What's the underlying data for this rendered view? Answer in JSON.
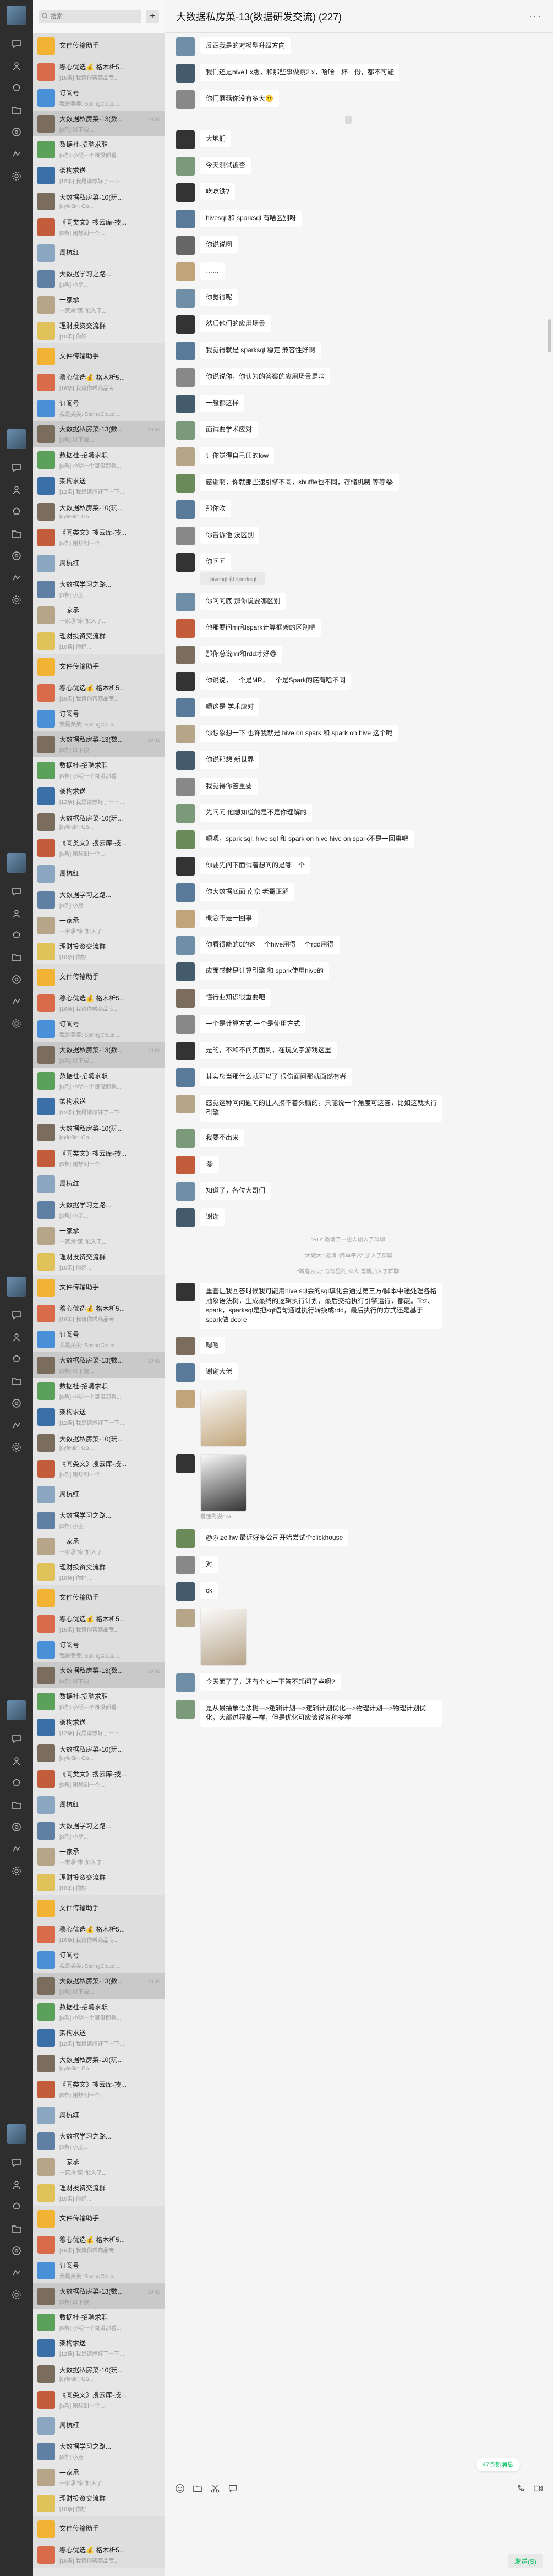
{
  "search": {
    "placeholder": "搜索"
  },
  "conversation": {
    "title": "大数据私房菜-13(数据研发交流) (227)",
    "more_icon": "more-dots-icon",
    "new_messages_tip": "47条新消息",
    "send_label": "发送(S)"
  },
  "chat_list": [
    {
      "name": "文件传输助手",
      "time": "",
      "preview": "",
      "color": "#f2b233",
      "pinned": true
    },
    {
      "name": "穆心优选💰 格木析5...",
      "time": "",
      "preview": "[16条] 我请你帮商品专...",
      "color": "#d96b4b",
      "badge": "",
      "pinned": true
    },
    {
      "name": "订阅号",
      "time": "",
      "preview": "我是美美: SpringCloud...",
      "color": "#4a90d9",
      "pinned": true
    },
    {
      "name": "大数据私房菜-13(数...",
      "time": "19:41",
      "preview": "[3条] 以下被...",
      "color": "#7a6d5e",
      "active": true
    },
    {
      "name": "数据社-招聘求职",
      "time": "",
      "preview": "[6条] 小明一个哥没都看...",
      "color": "#5ba05b",
      "badge": ""
    },
    {
      "name": "架构求送",
      "time": "",
      "preview": "[12条] 我是请想好了一下...",
      "color": "#3a6fa8",
      "badge": ""
    },
    {
      "name": "大数据私房菜-10(玩...",
      "time": "",
      "preview": "[cyfe6in: Go...",
      "color": "#7a6d5e",
      "badge": ""
    },
    {
      "name": "《同类文》搜云库-技...",
      "time": "",
      "preview": "[5条] 刚想到一个...",
      "color": "#c25c3a",
      "badge": ""
    },
    {
      "name": "周杭红",
      "time": "",
      "preview": "",
      "color": "#8aa6c1"
    },
    {
      "name": "大数据学习之路...",
      "time": "",
      "preview": "[3条] 小朋...",
      "color": "#5f7fa3",
      "badge": ""
    },
    {
      "name": "一家承",
      "time": "",
      "preview": "一家承\"家\"加入了...",
      "color": "#b7a58a"
    },
    {
      "name": "理财投资交流群",
      "time": "",
      "preview": "[10条] 你好...",
      "color": "#e0c25a"
    }
  ],
  "messages": [
    {
      "type": "in",
      "sender": "",
      "text": "反正我是的对模型升级方向",
      "color": "#6e8fa6"
    },
    {
      "type": "in",
      "sender": "",
      "text": "我们还是hive1.x版，和那些事做跳2.x，哈哈一杯一份，都不可能",
      "color": "#445b6b"
    },
    {
      "type": "in",
      "sender": "",
      "text": "你们蘑菇你没有多大🙂",
      "color": "#888"
    },
    {
      "type": "sys",
      "text": "",
      "boxed": true
    },
    {
      "type": "in",
      "sender": "",
      "text": "大地们",
      "color": "#333"
    },
    {
      "type": "in",
      "sender": "",
      "text": "今天测试被否",
      "color": "#7a9a7a"
    },
    {
      "type": "in",
      "sender": "",
      "text": "吃吃铁?",
      "color": "#333"
    },
    {
      "type": "in",
      "sender": "",
      "text": "hivesql 和 sparksql 有啥区别呀",
      "color": "#5a7a9a"
    },
    {
      "type": "in",
      "sender": "",
      "text": "你说说啊",
      "color": "#666"
    },
    {
      "type": "in",
      "sender": "",
      "text": "……",
      "color": "#c1a57a"
    },
    {
      "type": "in",
      "sender": "",
      "text": "你觉得呢",
      "color": "#6e8fa6"
    },
    {
      "type": "in",
      "sender": "",
      "text": "然后他们的应用场景",
      "color": "#333"
    },
    {
      "type": "in",
      "sender": "",
      "text": "我觉得就是 sparksql 稳定 兼容性好啊",
      "color": "#5a7a9a"
    },
    {
      "type": "in",
      "sender": "",
      "text": "你说说你，你认为的答案的应用场景是啥",
      "color": "#888"
    },
    {
      "type": "in",
      "sender": "",
      "text": "一般都这样",
      "color": "#445b6b"
    },
    {
      "type": "in",
      "sender": "",
      "text": "面试要学术应对",
      "color": "#7a9a7a"
    },
    {
      "type": "in",
      "sender": "",
      "text": "让你觉得自己印的low",
      "color": "#b7a58a"
    },
    {
      "type": "in",
      "sender": "",
      "text": "感谢啊，你就那些速引擎不同，shuffle也不同，存储机制 等等😂",
      "color": "#6a8a5a"
    },
    {
      "type": "in",
      "sender": "",
      "text": "那你吹",
      "color": "#5a7a9a"
    },
    {
      "type": "in",
      "sender": "",
      "text": "你告诉他 没区别",
      "color": "#888"
    },
    {
      "type": "in",
      "sender": "",
      "text": "你问问",
      "color": "#333",
      "quote": "：hivesql 和 sparksql..."
    },
    {
      "type": "in",
      "sender": "",
      "text": "你问问底 那你说要哪区别",
      "color": "#6e8fa6"
    },
    {
      "type": "in",
      "sender": "",
      "text": "他那要问mr和spark计算框架的区别吧",
      "color": "#c25c3a"
    },
    {
      "type": "in",
      "sender": "",
      "text": "那你总说mr和rdd才好😂",
      "color": "#7a6d5e"
    },
    {
      "type": "in",
      "sender": "",
      "text": "你说说，一个是MR，一个是Spark的底有啥不同",
      "color": "#333"
    },
    {
      "type": "in",
      "sender": "",
      "text": "嗯这是 学术应对",
      "color": "#5a7a9a"
    },
    {
      "type": "in",
      "sender": "",
      "text": "你想象想一下 也许我就是 hive on spark 和 spark on hive 这个呢",
      "color": "#b7a58a"
    },
    {
      "type": "in",
      "sender": "",
      "text": "你说那想 新世界",
      "color": "#445b6b"
    },
    {
      "type": "in",
      "sender": "",
      "text": "我觉得你答重要",
      "color": "#888"
    },
    {
      "type": "in",
      "sender": "",
      "text": "先问问 他想知道的是不是你理解的",
      "color": "#7a9a7a"
    },
    {
      "type": "in",
      "sender": "",
      "text": "嗯嗯，spark sql: hive sql 和 spark on hive hive on spark不是一回事吧",
      "color": "#6a8a5a"
    },
    {
      "type": "in",
      "sender": "",
      "text": "你要先问下面试者想问的是哪一个",
      "color": "#333"
    },
    {
      "type": "in",
      "sender": "",
      "text": "你大数据底面 南京 老哥正解",
      "color": "#5a7a9a"
    },
    {
      "type": "in",
      "sender": "",
      "text": "概念不是一回事",
      "color": "#c1a57a"
    },
    {
      "type": "in",
      "sender": "",
      "text": "你看得能的0的这 一个hive用得 一个rdd用得",
      "color": "#6e8fa6"
    },
    {
      "type": "in",
      "sender": "",
      "text": "应面感就是计算引擎 和 spark使用hive的",
      "color": "#445b6b"
    },
    {
      "type": "in",
      "sender": "",
      "text": "懂行业知识很重要吧",
      "color": "#7a6d5e"
    },
    {
      "type": "in",
      "sender": "",
      "text": "一个是计算方式 一个是使用方式",
      "color": "#888"
    },
    {
      "type": "in",
      "sender": "",
      "text": "是的，不和不问实面到，在玩文字游戏这里",
      "color": "#333"
    },
    {
      "type": "in",
      "sender": "",
      "text": "其实您当那什么就可以了 很伤面问那就面然有者",
      "color": "#5a7a9a"
    },
    {
      "type": "in",
      "sender": "",
      "text": "感觉这种问问题问的让人摸不着头脑的，只能说一个角度可这答，比如这就执行引擎",
      "color": "#b7a58a"
    },
    {
      "type": "in",
      "sender": "",
      "text": "我要不出来",
      "color": "#7a9a7a"
    },
    {
      "type": "in",
      "sender": "",
      "text": "😂",
      "color": "#c25c3a"
    },
    {
      "type": "in",
      "sender": "",
      "text": "知道了，各位大哥们",
      "color": "#6e8fa6"
    },
    {
      "type": "in",
      "sender": "",
      "text": "谢谢",
      "color": "#445b6b"
    },
    {
      "type": "sys",
      "text": "\"RD\" 邀请了一些人加入了群聊",
      "boxed": false
    },
    {
      "type": "sys",
      "text": "\"大姐大\" 邀请 \"简单平常\" 加入了群聊",
      "boxed": false
    },
    {
      "type": "sys",
      "text": "\"新春方丈\" 与群里的 众人 邀请加入了群聊",
      "boxed": false
    },
    {
      "type": "in",
      "sender": "",
      "text": "重查让我回答时候我可能用hive sql会的sql填化会通过第三方/脚本中途处理各格抽象语法树，生成最终的逻辑执行计划，最后交给执行引擎运行，都能。Tez、spark，sparksql是把sql语句通过执行转换成rdd，最后执行的方式还是基于spark做 dcore",
      "color": "#333"
    },
    {
      "type": "in",
      "sender": "",
      "text": "嗯嗯",
      "color": "#7a6d5e"
    },
    {
      "type": "in",
      "sender": "",
      "text": "谢谢大佬",
      "color": "#5a7a9a"
    },
    {
      "type": "img",
      "sender": "",
      "color": "#c1a57a"
    },
    {
      "type": "img",
      "sender": "",
      "color": "#333",
      "caption": "看懂先说oka"
    },
    {
      "type": "in",
      "sender": "",
      "text": "@◎ ≥e hw 最近好多公司开始尝试个clickhouse",
      "color": "#6a8a5a"
    },
    {
      "type": "in",
      "sender": "",
      "text": "对",
      "color": "#888"
    },
    {
      "type": "in",
      "sender": "",
      "text": "ck",
      "color": "#445b6b"
    },
    {
      "type": "img",
      "sender": "",
      "color": "#b7a58a"
    },
    {
      "type": "in",
      "sender": "",
      "text": "今天面了了，还有个!cl一下答不起问了些嗯?",
      "color": "#6e8fa6"
    },
    {
      "type": "in",
      "sender": "",
      "text": "是从最抽象语法树—>逻辑计划—>逻辑计划优化—>物理计划—>物理计划优化，大部过程都一样，但是优化可应该说各种多样",
      "color": "#7a9a7a"
    }
  ]
}
